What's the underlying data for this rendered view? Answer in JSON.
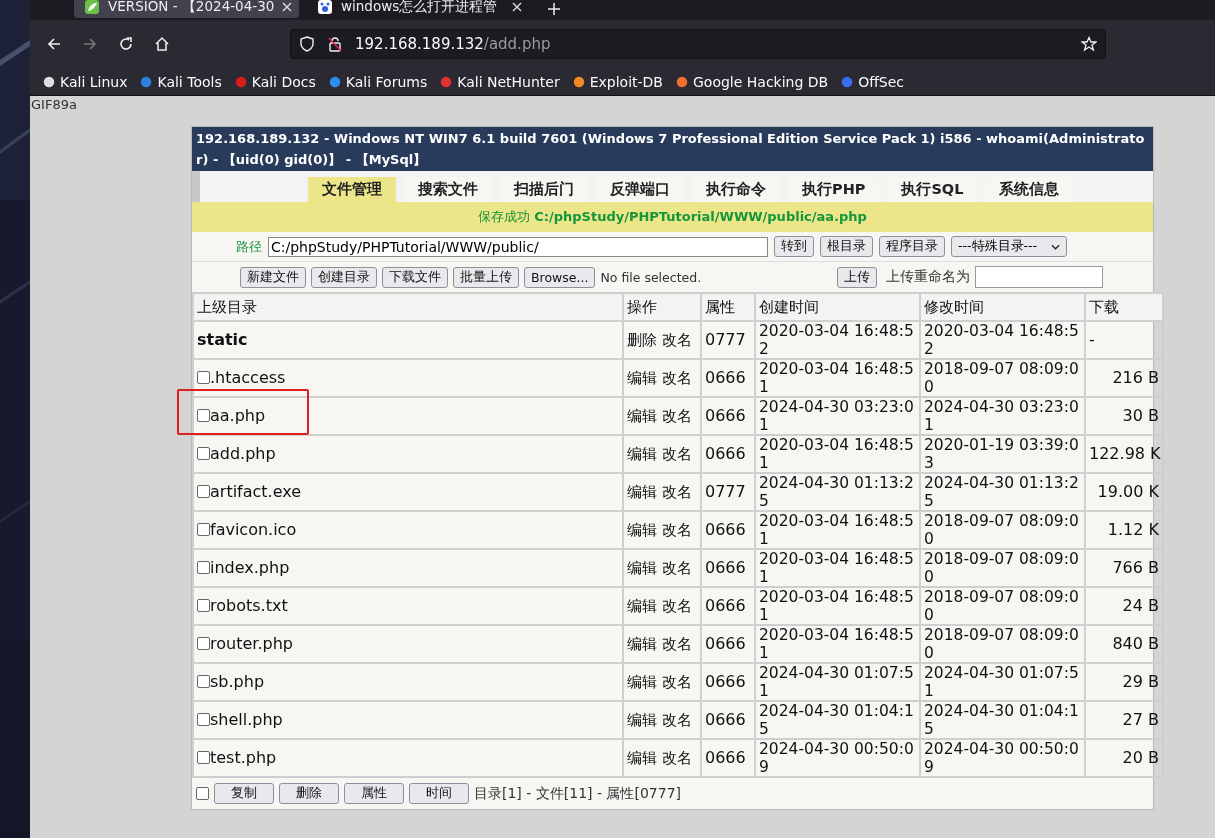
{
  "browser": {
    "tabs": [
      {
        "title": "VERSION - 【2024-04-30",
        "selected": true
      },
      {
        "title": "windows怎么打开进程管",
        "selected": false
      }
    ],
    "url": {
      "host": "192.168.189.132",
      "path": "/add.php"
    },
    "bookmarks": [
      "Kali Linux",
      "Kali Tools",
      "Kali Docs",
      "Kali Forums",
      "Kali NetHunter",
      "Exploit-DB",
      "Google Hacking DB",
      "OffSec"
    ]
  },
  "page": {
    "preamble": "GIF89a",
    "header": "192.168.189.132 - Windows NT WIN7 6.1 build 7601 (Windows 7 Professional Edition Service Pack 1) i586 - whoami(Administrator) - 【uid(0) gid(0)】 - 【MySql】",
    "nav_tabs": [
      {
        "label": "文件管理",
        "selected": true
      },
      {
        "label": "搜索文件",
        "selected": false
      },
      {
        "label": "扫描后门",
        "selected": false
      },
      {
        "label": "反弹端口",
        "selected": false
      },
      {
        "label": "执行命令",
        "selected": false
      },
      {
        "label": "执行PHP",
        "selected": false
      },
      {
        "label": "执行SQL",
        "selected": false
      },
      {
        "label": "系统信息",
        "selected": false
      }
    ],
    "message": "保存成功 **C:/phpStudy/PHPTutorial/WWW/public/aa.php**",
    "path_bar": {
      "label": "路径",
      "value": "C:/phpStudy/PHPTutorial/WWW/public/",
      "buttons": [
        "转到",
        "根目录",
        "程序目录"
      ],
      "select": "---特殊目录---"
    },
    "upload_bar": {
      "buttons": [
        "新建文件",
        "创建目录",
        "下载文件",
        "批量上传"
      ],
      "file_button": "Browse...",
      "file_status": "No file selected.",
      "upload_button": "上传",
      "rename_label": "上传重命名为"
    },
    "table": {
      "columns": [
        "上级目录",
        "操作",
        "属性",
        "创建时间",
        "修改时间",
        "下载"
      ],
      "rows": [
        {
          "kind": "dir",
          "name": "static",
          "actions": [
            "删除",
            "改名"
          ],
          "perm": "0777",
          "created": "2020-03-04 16:48:52",
          "modified": "2020-03-04 16:48:52",
          "size": "-",
          "highlighted": false
        },
        {
          "kind": "file",
          "name": ".htaccess",
          "checked": false,
          "actions": [
            "编辑",
            "改名"
          ],
          "perm": "0666",
          "created": "2020-03-04 16:48:51",
          "modified": "2018-09-07 08:09:00",
          "size": "216 B",
          "highlighted": false
        },
        {
          "kind": "file",
          "name": "aa.php",
          "checked": false,
          "actions": [
            "编辑",
            "改名"
          ],
          "perm": "0666",
          "created": "2024-04-30 03:23:01",
          "modified": "2024-04-30 03:23:01",
          "size": "30 B",
          "highlighted": true
        },
        {
          "kind": "file",
          "name": "add.php",
          "checked": false,
          "actions": [
            "编辑",
            "改名"
          ],
          "perm": "0666",
          "created": "2020-03-04 16:48:51",
          "modified": "2020-01-19 03:39:03",
          "size": "122.98 K",
          "highlighted": false
        },
        {
          "kind": "file",
          "name": "artifact.exe",
          "checked": false,
          "actions": [
            "编辑",
            "改名"
          ],
          "perm": "0777",
          "created": "2024-04-30 01:13:25",
          "modified": "2024-04-30 01:13:25",
          "size": "19.00 K",
          "highlighted": false
        },
        {
          "kind": "file",
          "name": "favicon.ico",
          "checked": false,
          "actions": [
            "编辑",
            "改名"
          ],
          "perm": "0666",
          "created": "2020-03-04 16:48:51",
          "modified": "2018-09-07 08:09:00",
          "size": "1.12 K",
          "highlighted": false
        },
        {
          "kind": "file",
          "name": "index.php",
          "checked": false,
          "actions": [
            "编辑",
            "改名"
          ],
          "perm": "0666",
          "created": "2020-03-04 16:48:51",
          "modified": "2018-09-07 08:09:00",
          "size": "766 B",
          "highlighted": false
        },
        {
          "kind": "file",
          "name": "robots.txt",
          "checked": false,
          "actions": [
            "编辑",
            "改名"
          ],
          "perm": "0666",
          "created": "2020-03-04 16:48:51",
          "modified": "2018-09-07 08:09:00",
          "size": "24 B",
          "highlighted": false
        },
        {
          "kind": "file",
          "name": "router.php",
          "checked": false,
          "actions": [
            "编辑",
            "改名"
          ],
          "perm": "0666",
          "created": "2020-03-04 16:48:51",
          "modified": "2018-09-07 08:09:00",
          "size": "840 B",
          "highlighted": false
        },
        {
          "kind": "file",
          "name": "sb.php",
          "checked": false,
          "actions": [
            "编辑",
            "改名"
          ],
          "perm": "0666",
          "created": "2024-04-30 01:07:51",
          "modified": "2024-04-30 01:07:51",
          "size": "29 B",
          "highlighted": false
        },
        {
          "kind": "file",
          "name": "shell.php",
          "checked": false,
          "actions": [
            "编辑",
            "改名"
          ],
          "perm": "0666",
          "created": "2024-04-30 01:04:15",
          "modified": "2024-04-30 01:04:15",
          "size": "27 B",
          "highlighted": false
        },
        {
          "kind": "file",
          "name": "test.php",
          "checked": false,
          "actions": [
            "编辑",
            "改名"
          ],
          "perm": "0666",
          "created": "2024-04-30 00:50:09",
          "modified": "2024-04-30 00:50:09",
          "size": "20 B",
          "highlighted": false
        }
      ]
    },
    "footer": {
      "select_all": false,
      "buttons": [
        "复制",
        "删除",
        "属性",
        "时间"
      ],
      "summary": "目录[1] - 文件[11] - 属性[0777]"
    }
  }
}
